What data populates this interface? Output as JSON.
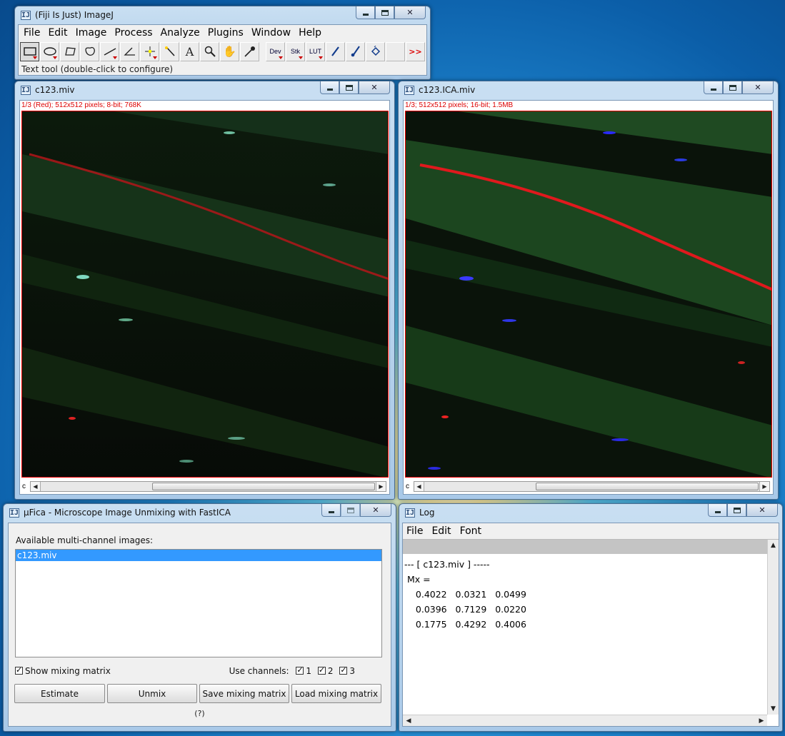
{
  "imagej": {
    "title": "(Fiji Is Just) ImageJ",
    "menu": [
      "File",
      "Edit",
      "Image",
      "Process",
      "Analyze",
      "Plugins",
      "Window",
      "Help"
    ],
    "tool_labels": {
      "dev": "Dev",
      "stk": "Stk",
      "lut": "LUT",
      "more": ">>"
    },
    "status": "Text tool (double-click to configure)"
  },
  "img1": {
    "title": "c123.miv",
    "info": "1/3 (Red); 512x512 pixels; 8-bit; 768K",
    "channel_letter": "c"
  },
  "img2": {
    "title": "c123.ICA.miv",
    "info": "1/3; 512x512 pixels; 16-bit; 1.5MB",
    "channel_letter": "c"
  },
  "fica": {
    "title": "µFica - Microscope Image Unmixing with FastICA",
    "available_label": "Available multi-channel images:",
    "images": [
      "c123.miv"
    ],
    "show_matrix_label": "Show mixing matrix",
    "use_channels_label": "Use channels:",
    "channels": [
      "1",
      "2",
      "3"
    ],
    "buttons": {
      "estimate": "Estimate",
      "unmix": "Unmix",
      "save": "Save mixing matrix",
      "load": "Load mixing matrix"
    },
    "help": "(?)"
  },
  "log": {
    "title": "Log",
    "menu": [
      "File",
      "Edit",
      "Font"
    ],
    "lines": [
      "--- [ c123.miv ] -----",
      " Mx =",
      "    0.4022   0.0321   0.0499",
      "    0.0396   0.7129   0.0220",
      "    0.1775   0.4292   0.4006"
    ]
  },
  "colors": {
    "info_text": "#dd0000",
    "selection": "#3399ff"
  }
}
